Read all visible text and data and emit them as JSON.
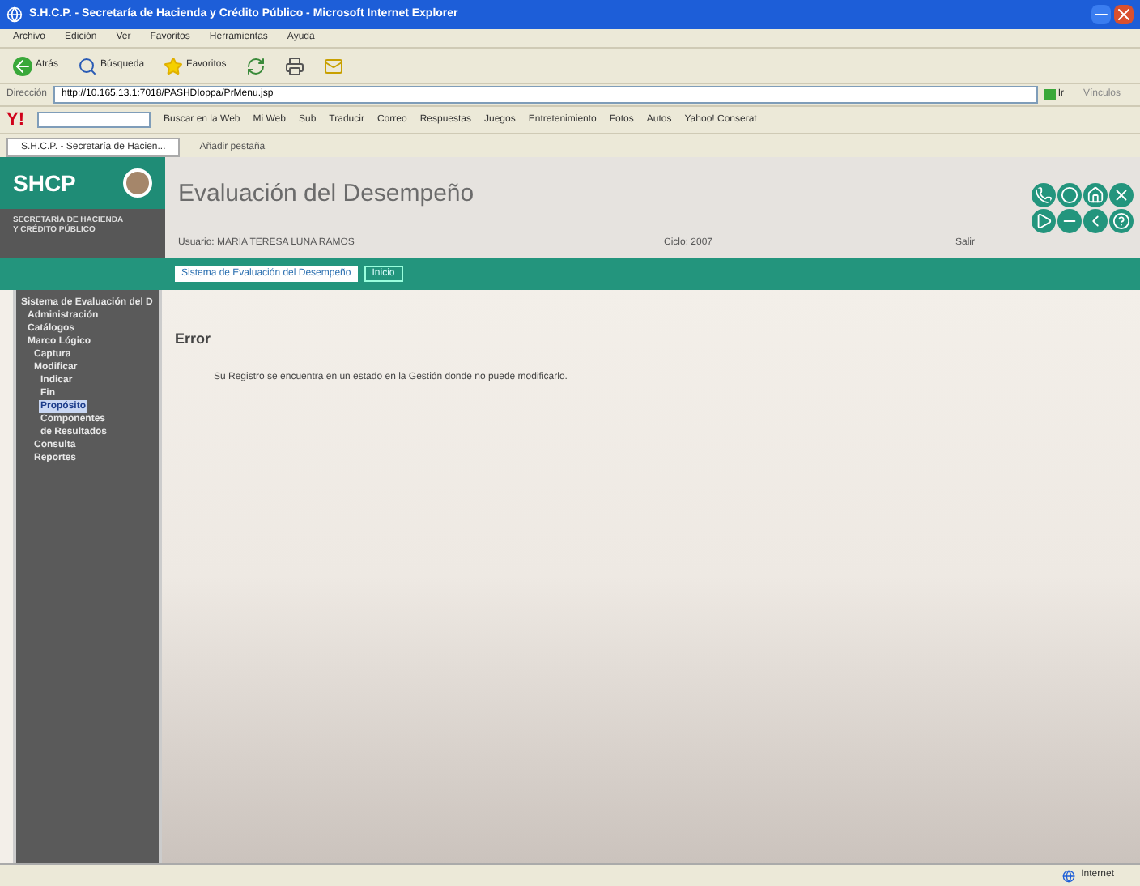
{
  "window": {
    "title": "S.H.C.P. - Secretaría de Hacienda y Crédito Público - Microsoft Internet Explorer"
  },
  "menu": [
    "Archivo",
    "Edición",
    "Ver",
    "Favoritos",
    "Herramientas",
    "Ayuda"
  ],
  "toolbar": [
    {
      "label": "Atrás",
      "kind": "back"
    },
    {
      "label": "Búsqueda",
      "kind": "search"
    },
    {
      "label": "Favoritos",
      "kind": "star"
    }
  ],
  "address": {
    "label": "Dirección",
    "value": "http://10.165.13.1:7018/PASHDIoppa/PrMenu.jsp",
    "go": "Ir",
    "links": "Vínculos"
  },
  "yahoo_bar": {
    "logo": "Y!",
    "search_button": "Buscar en la Web",
    "items": [
      "Mi Web",
      "Sub",
      "Traducir",
      "Correo",
      "Respuestas",
      "Juegos",
      "Entretenimiento",
      "Fotos",
      "Autos",
      "Yahoo! Conserat"
    ]
  },
  "browser_tabs": [
    {
      "label": "S.H.C.P. - Secretaría de Hacien...",
      "selected": true
    },
    {
      "label": "Añadir pestaña",
      "selected": false
    }
  ],
  "header": {
    "logo": "SHCP",
    "agency": "SECRETARÍA DE HACIENDA Y CRÉDITO PÚBLICO",
    "title": "Evaluación del Desempeño",
    "user": "Usuario: MARIA TERESA LUNA RAMOS",
    "cycle": "Ciclo: 2007",
    "logout": "Salir"
  },
  "page_tabs": [
    {
      "label": "Sistema de Evaluación del Desempeño",
      "selected": true
    },
    {
      "label": "Inicio",
      "selected": false
    }
  ],
  "sidebar": {
    "items": [
      {
        "label": "Sistema de Evaluación del D",
        "selected": false,
        "children": [
          {
            "label": "Administración",
            "selected": false
          },
          {
            "label": "Catálogos",
            "selected": false
          },
          {
            "label": "Marco Lógico",
            "selected": false,
            "children": [
              {
                "label": "Captura",
                "selected": false
              },
              {
                "label": "Modificar",
                "selected": false,
                "children": [
                  {
                    "label": "Indicar",
                    "selected": false
                  },
                  {
                    "label": "Fin",
                    "selected": false
                  },
                  {
                    "label": "Propósito",
                    "selected": true
                  },
                  {
                    "label": "Componentes",
                    "selected": false
                  },
                  {
                    "label": "de Resultados",
                    "selected": false
                  }
                ]
              },
              {
                "label": "Consulta",
                "selected": false
              },
              {
                "label": "Reportes",
                "selected": false
              }
            ]
          }
        ]
      }
    ]
  },
  "content": {
    "heading": "Error",
    "message": "Su Registro se encuentra en un estado en la Gestión donde no puede modificarlo."
  },
  "status_bar": {
    "zone": "Internet"
  }
}
